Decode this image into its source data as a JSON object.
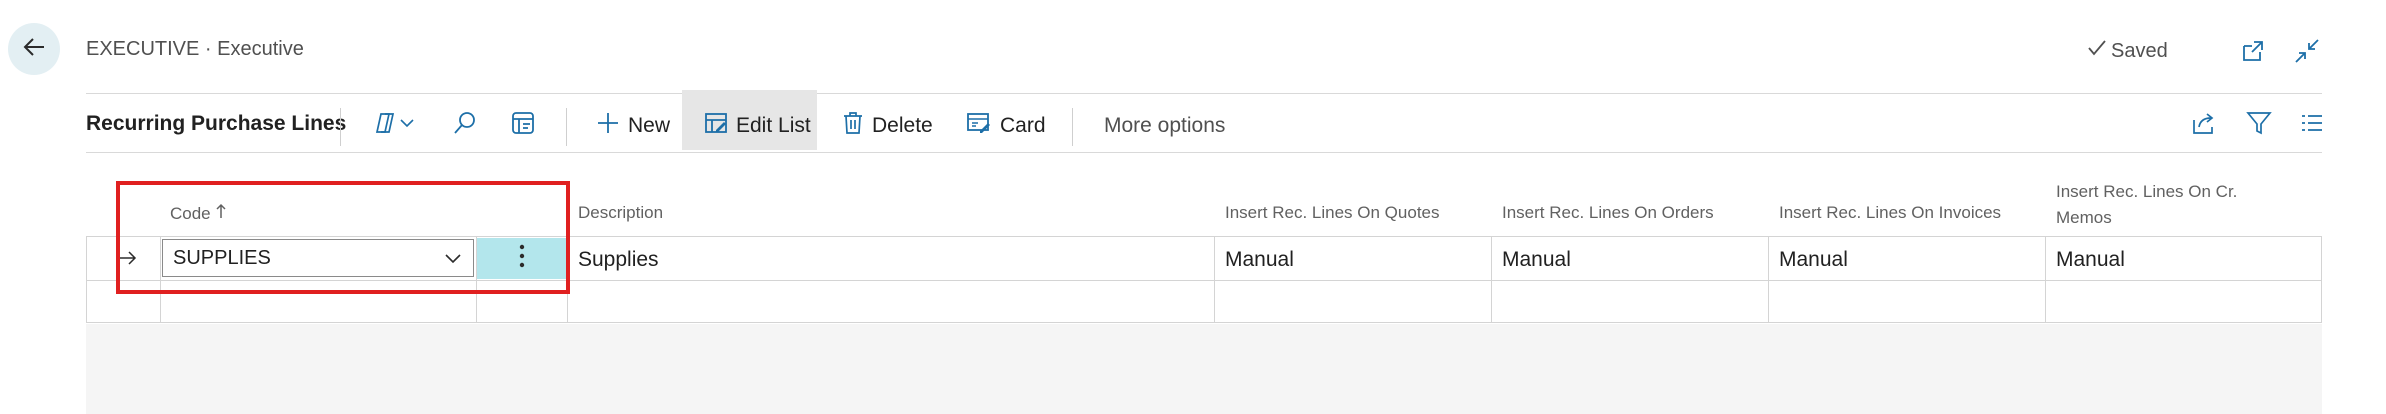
{
  "header": {
    "breadcrumb": "EXECUTIVE · Executive",
    "saved_label": "Saved"
  },
  "actionbar": {
    "page_title": "Recurring Purchase Lines",
    "new_label": "New",
    "edit_list_label": "Edit List",
    "delete_label": "Delete",
    "card_label": "Card",
    "more_options_label": "More options"
  },
  "table": {
    "columns": {
      "code": "Code",
      "description": "Description",
      "quotes": "Insert Rec. Lines On Quotes",
      "orders": "Insert Rec. Lines On Orders",
      "invoices": "Insert Rec. Lines On Invoices",
      "cr_memos_line1": "Insert Rec. Lines On Cr.",
      "cr_memos_line2": "Memos"
    },
    "rows": [
      {
        "code": "SUPPLIES",
        "description": "Supplies",
        "quotes": "Manual",
        "orders": "Manual",
        "invoices": "Manual",
        "cr_memos": "Manual"
      }
    ]
  },
  "colors": {
    "accent": "#b3e6ec",
    "highlight": "#e02020",
    "back_button": "#e3eff3"
  },
  "icons": [
    "arrow-left-icon",
    "checkmark-icon",
    "open-new-window-icon",
    "collapse-icon",
    "copilot-icon",
    "chevron-down-icon",
    "search-icon",
    "analyze-icon",
    "plus-icon",
    "edit-list-icon",
    "trash-icon",
    "card-icon",
    "share-icon",
    "filter-icon",
    "list-icon",
    "row-arrow-icon",
    "vertical-dots-icon",
    "sort-up-arrow-icon"
  ]
}
